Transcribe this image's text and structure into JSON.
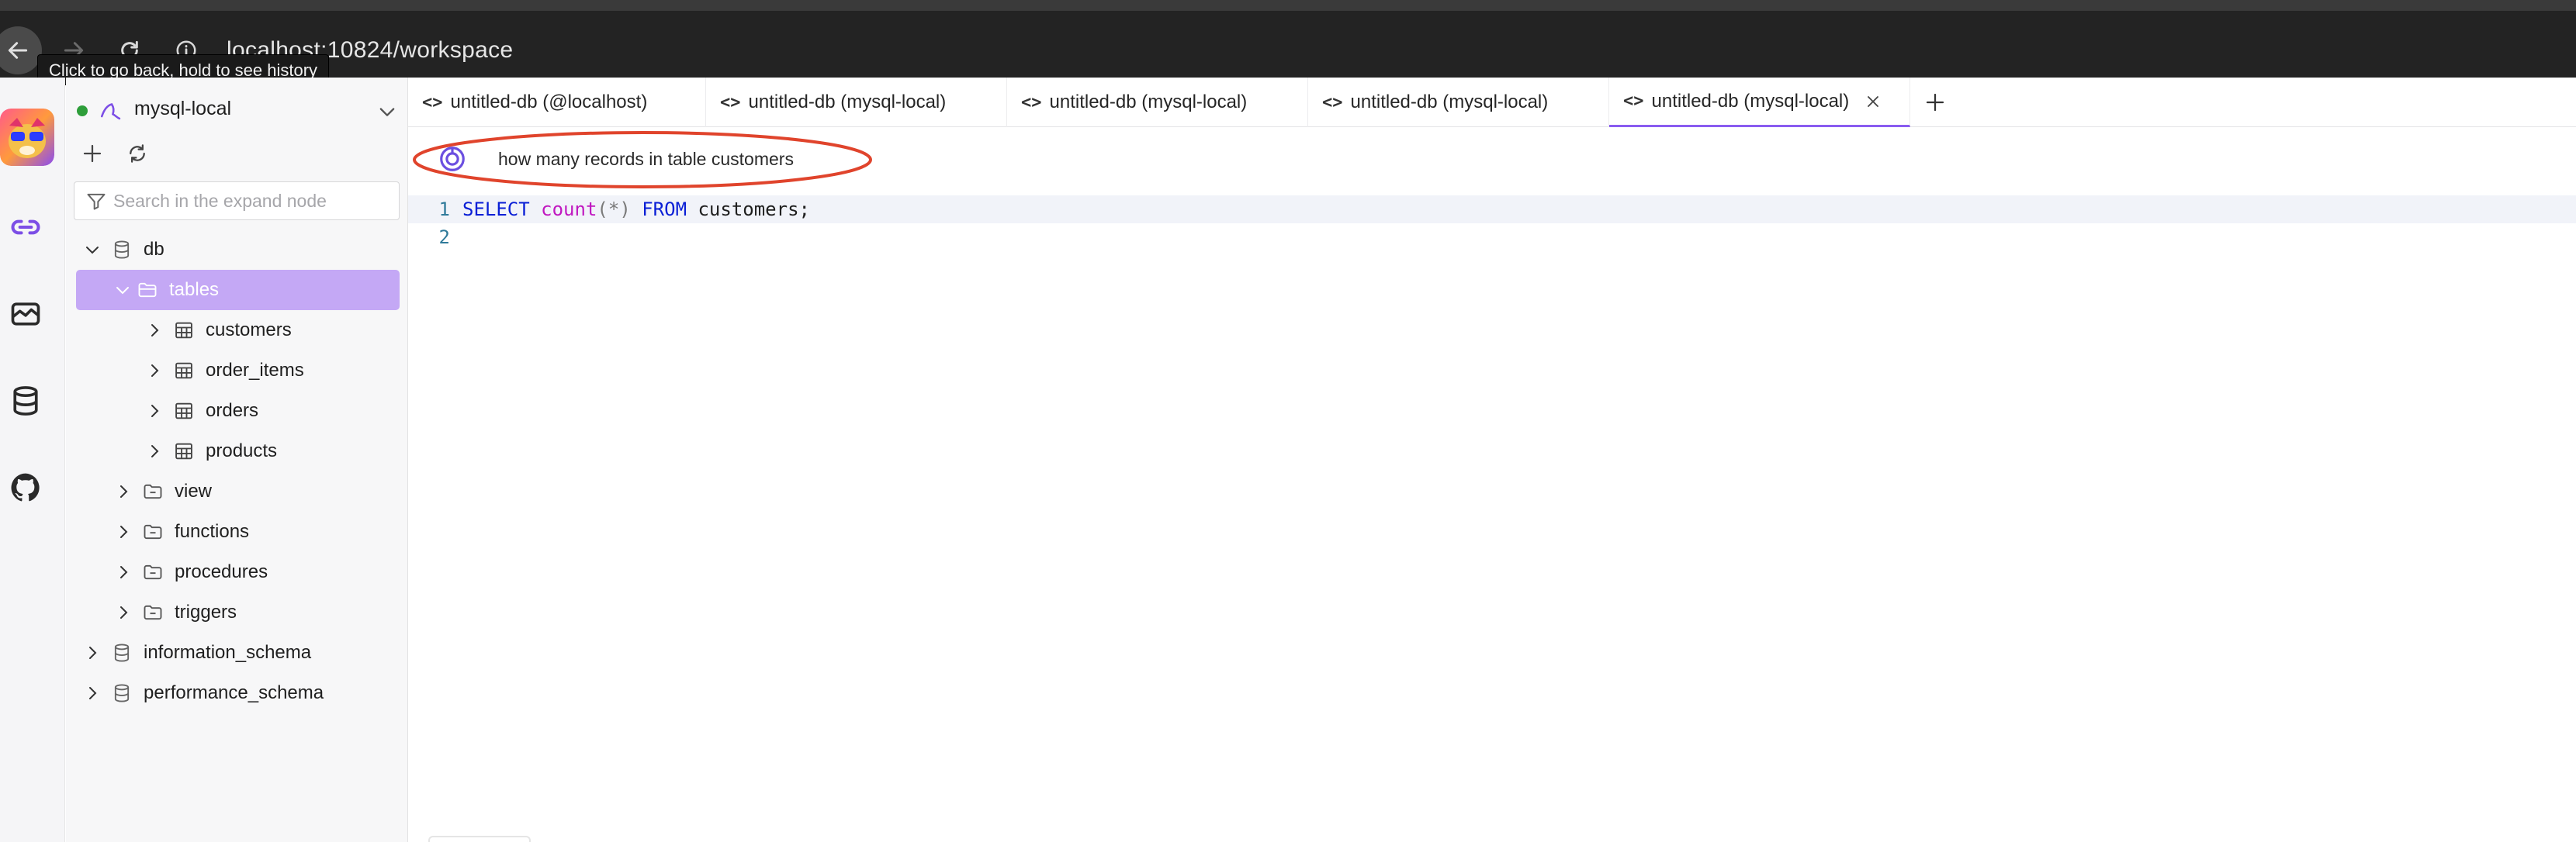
{
  "browser": {
    "url": "localhost:10824/workspace",
    "tooltip": "Click to go back, hold to see history"
  },
  "connection": {
    "name": "mysql-local",
    "status_color": "#2e9e3a"
  },
  "explorer": {
    "search_placeholder": "Search in the expand node",
    "tree": {
      "db": "db",
      "tables": "tables",
      "table_items": [
        "customers",
        "order_items",
        "orders",
        "products"
      ],
      "view": "view",
      "functions": "functions",
      "procedures": "procedures",
      "triggers": "triggers",
      "information_schema": "information_schema",
      "performance_schema": "performance_schema"
    }
  },
  "tabs": [
    {
      "label": "untitled-db (@localhost)",
      "active": false
    },
    {
      "label": "untitled-db (mysql-local)",
      "active": false
    },
    {
      "label": "untitled-db (mysql-local)",
      "active": false
    },
    {
      "label": "untitled-db (mysql-local)",
      "active": false
    },
    {
      "label": "untitled-db (mysql-local)",
      "active": true
    }
  ],
  "ai_prompt": {
    "text": "how many records in table customers",
    "highlight_color": "#e0442c"
  },
  "editor": {
    "line_numbers": [
      "1",
      "2"
    ],
    "sql": {
      "select": "SELECT",
      "func": "count",
      "open": "(",
      "star": "*",
      "close": ")",
      "from": "FROM",
      "table": "customers;"
    }
  },
  "colors": {
    "accent": "#8a5cf0",
    "selected_node": "#c4a8f5",
    "keyword": "#0a1fd6",
    "function": "#c018c0"
  },
  "icons": {
    "rail": [
      "app-logo-icon",
      "connections-icon",
      "dashboard-icon",
      "database-icon",
      "github-icon"
    ]
  }
}
